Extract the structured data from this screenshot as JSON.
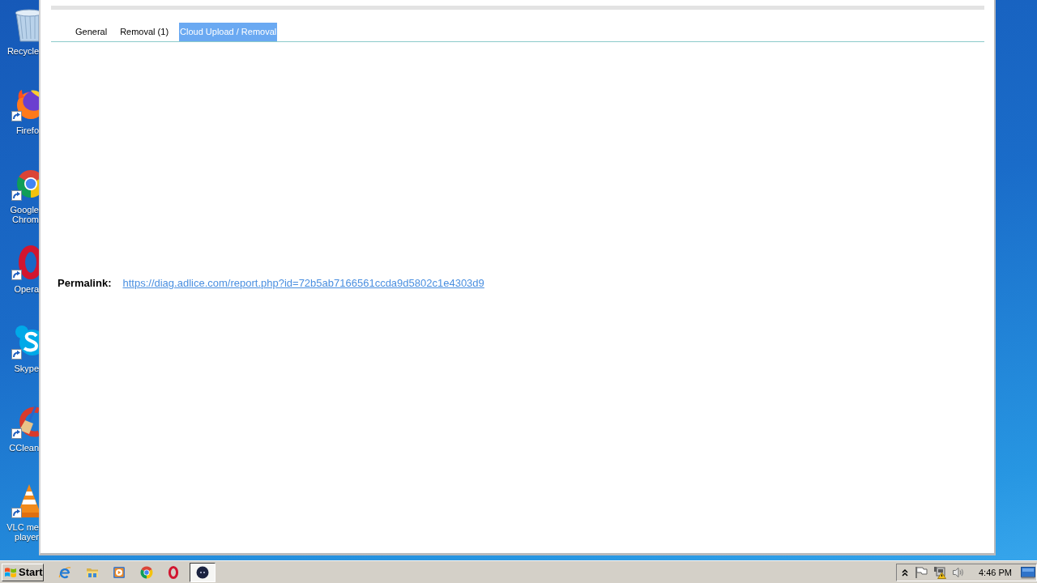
{
  "desktop_icons": [
    {
      "kind": "trash",
      "label": "Recycle",
      "shortcut": false
    },
    {
      "kind": "fox",
      "label": "Firefo",
      "shortcut": true
    },
    {
      "kind": "ring",
      "label": "Google Chrom",
      "shortcut": true
    },
    {
      "kind": "o",
      "label": "Opera",
      "shortcut": true
    },
    {
      "kind": "s",
      "label": "Skype",
      "shortcut": true
    },
    {
      "kind": "brush",
      "label": "CClean",
      "shortcut": true
    },
    {
      "kind": "cone",
      "label": "VLC me player",
      "shortcut": true
    }
  ],
  "window": {
    "tabs": [
      {
        "label": "General",
        "selected": false
      },
      {
        "label": "Removal (1)",
        "selected": false
      },
      {
        "label": "Cloud Upload / Removal",
        "selected": true
      }
    ],
    "permalink": {
      "label": "Permalink:",
      "url": "https://diag.adlice.com/report.php?id=72b5ab7166561ccda9d5802c1e4303d9"
    }
  },
  "taskbar": {
    "start": "Start",
    "buttons": [
      {
        "kind": "e",
        "active": false
      },
      {
        "kind": "folder",
        "active": false
      },
      {
        "kind": "play",
        "active": false
      },
      {
        "kind": "ring",
        "active": false
      },
      {
        "kind": "o",
        "active": false
      },
      {
        "kind": "app",
        "active": true
      }
    ],
    "clock": "4:46 PM"
  }
}
